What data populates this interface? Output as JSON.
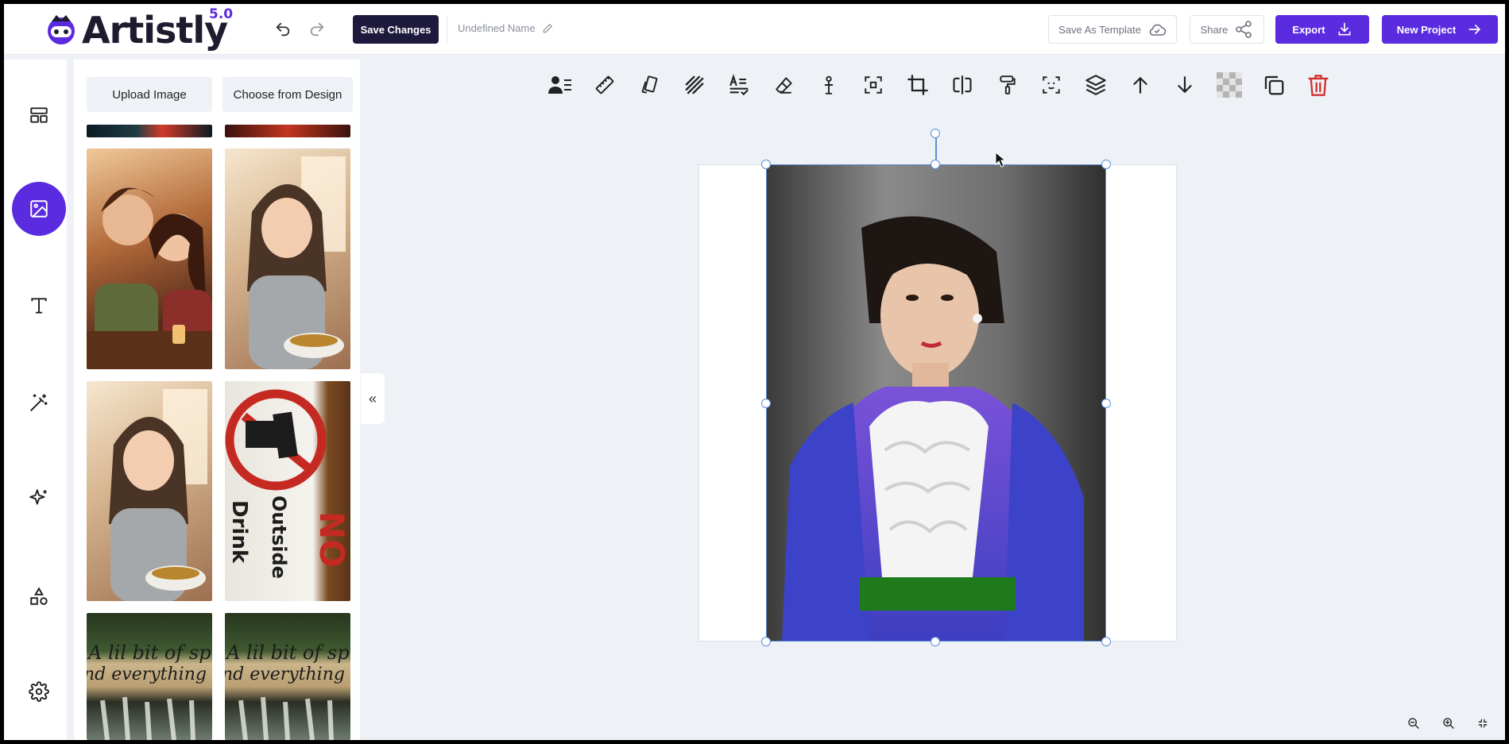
{
  "app": {
    "logo_text": "Artistly",
    "version": "5.0"
  },
  "header": {
    "save_label": "Save Changes",
    "doc_name": "Undefined Name",
    "save_template_label": "Save As Template",
    "share_label": "Share",
    "export_label": "Export",
    "new_project_label": "New Project"
  },
  "nav": {
    "items": [
      {
        "name": "layout-icon",
        "active": false
      },
      {
        "name": "image-icon",
        "active": true
      },
      {
        "name": "text-icon",
        "active": false
      },
      {
        "name": "magic-wand-icon",
        "active": false
      },
      {
        "name": "sparkles-icon",
        "active": false
      },
      {
        "name": "shapes-icon",
        "active": false
      },
      {
        "name": "gear-icon",
        "active": false
      }
    ]
  },
  "panel": {
    "upload_label": "Upload Image",
    "choose_label": "Choose from Design",
    "collapse_label": "«",
    "thumbs": [
      {
        "text": ""
      },
      {
        "text": ""
      },
      {
        "text": ""
      },
      {
        "text": ""
      },
      {
        "text": ""
      },
      {
        "text": "NO Outside Drink"
      },
      {
        "text": "A lil bit of spice and everything nice"
      },
      {
        "text": "A lil bit of spice and everything nice"
      }
    ]
  },
  "toolbar": {
    "tools": [
      "person-list-icon",
      "ruler-icon",
      "flip-cards-icon",
      "stripes-icon",
      "text-check-icon",
      "eraser-icon",
      "anchor-icon",
      "crop-frame-icon",
      "crop-icon",
      "flip-icon",
      "paint-roller-icon",
      "focus-icon",
      "layers-icon",
      "arrow-up-icon",
      "arrow-down-icon",
      "transparency-icon",
      "duplicate-icon",
      "trash-icon"
    ]
  },
  "colors": {
    "accent": "#5b2be0",
    "dark_button": "#1d1a3d",
    "delete": "#d32f2f",
    "selection": "#5a8fd6",
    "background": "#eef1f6"
  }
}
